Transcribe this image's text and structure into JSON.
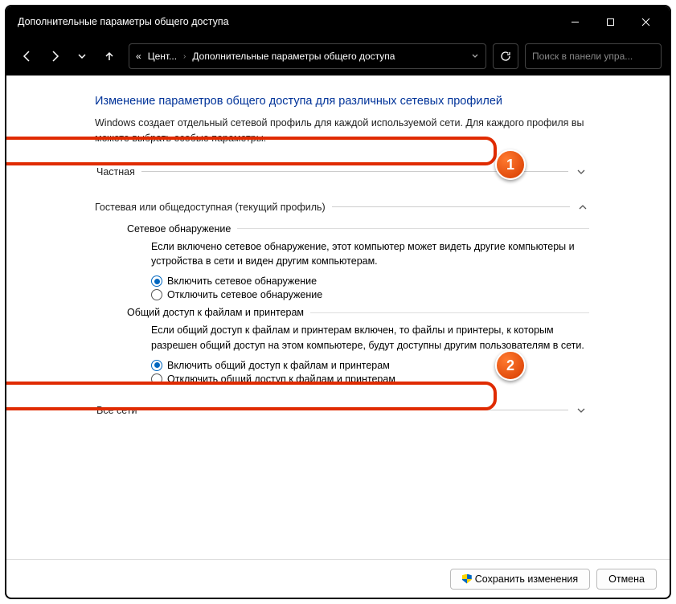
{
  "window": {
    "title": "Дополнительные параметры общего доступа"
  },
  "breadcrumb": {
    "prefix": "«",
    "part1": "Цент...",
    "part2": "Дополнительные параметры общего доступа"
  },
  "search": {
    "placeholder": "Поиск в панели упра..."
  },
  "page": {
    "title": "Изменение параметров общего доступа для различных сетевых профилей",
    "desc": "Windows создает отдельный сетевой профиль для каждой используемой сети. Для каждого профиля вы можете выбрать особые параметры."
  },
  "profiles": {
    "private": {
      "title": "Частная"
    },
    "guest": {
      "title": "Гостевая или общедоступная (текущий профиль)",
      "discovery": {
        "title": "Сетевое обнаружение",
        "desc": "Если включено сетевое обнаружение, этот компьютер может видеть другие компьютеры и устройства в сети и виден другим компьютерам.",
        "on": "Включить сетевое обнаружение",
        "off": "Отключить сетевое обнаружение"
      },
      "sharing": {
        "title": "Общий доступ к файлам и принтерам",
        "desc": "Если общий доступ к файлам и принтерам включен, то файлы и принтеры, к которым разрешен общий доступ на этом компьютере, будут доступны другим пользователям в сети.",
        "on": "Включить общий доступ к файлам и принтерам",
        "off": "Отключить общий доступ к файлам и принтерам"
      }
    },
    "all": {
      "title": "Все сети"
    }
  },
  "footer": {
    "save": "Сохранить изменения",
    "cancel": "Отмена"
  },
  "callouts": {
    "one": "1",
    "two": "2"
  }
}
